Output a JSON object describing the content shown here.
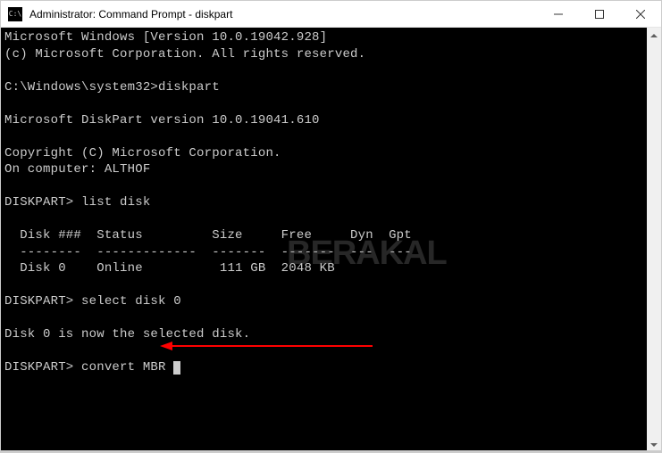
{
  "window": {
    "title": "Administrator: Command Prompt - diskpart",
    "icon_glyph": "C:\\"
  },
  "terminal": {
    "lines": {
      "l0": "Microsoft Windows [Version 10.0.19042.928]",
      "l1": "(c) Microsoft Corporation. All rights reserved.",
      "l2": "",
      "l3_prompt": "C:\\Windows\\system32>",
      "l3_cmd": "diskpart",
      "l4": "",
      "l5": "Microsoft DiskPart version 10.0.19041.610",
      "l6": "",
      "l7": "Copyright (C) Microsoft Corporation.",
      "l8_a": "On computer: ",
      "l8_b": "ALTHOF",
      "l9": "",
      "l10_prompt": "DISKPART> ",
      "l10_cmd": "list disk",
      "l11": "",
      "l12": "  Disk ###  Status         Size     Free     Dyn  Gpt",
      "l13": "  --------  -------------  -------  -------  ---  ---",
      "l14": "  Disk 0    Online          111 GB  2048 KB",
      "l15": "",
      "l16_prompt": "DISKPART> ",
      "l16_cmd": "select disk 0",
      "l17": "",
      "l18": "Disk 0 is now the selected disk.",
      "l19": "",
      "l20_prompt": "DISKPART> ",
      "l20_cmd": "convert MBR"
    }
  },
  "watermark": "BERAKAL",
  "annotation": {
    "arrow_color": "#ff0000"
  }
}
